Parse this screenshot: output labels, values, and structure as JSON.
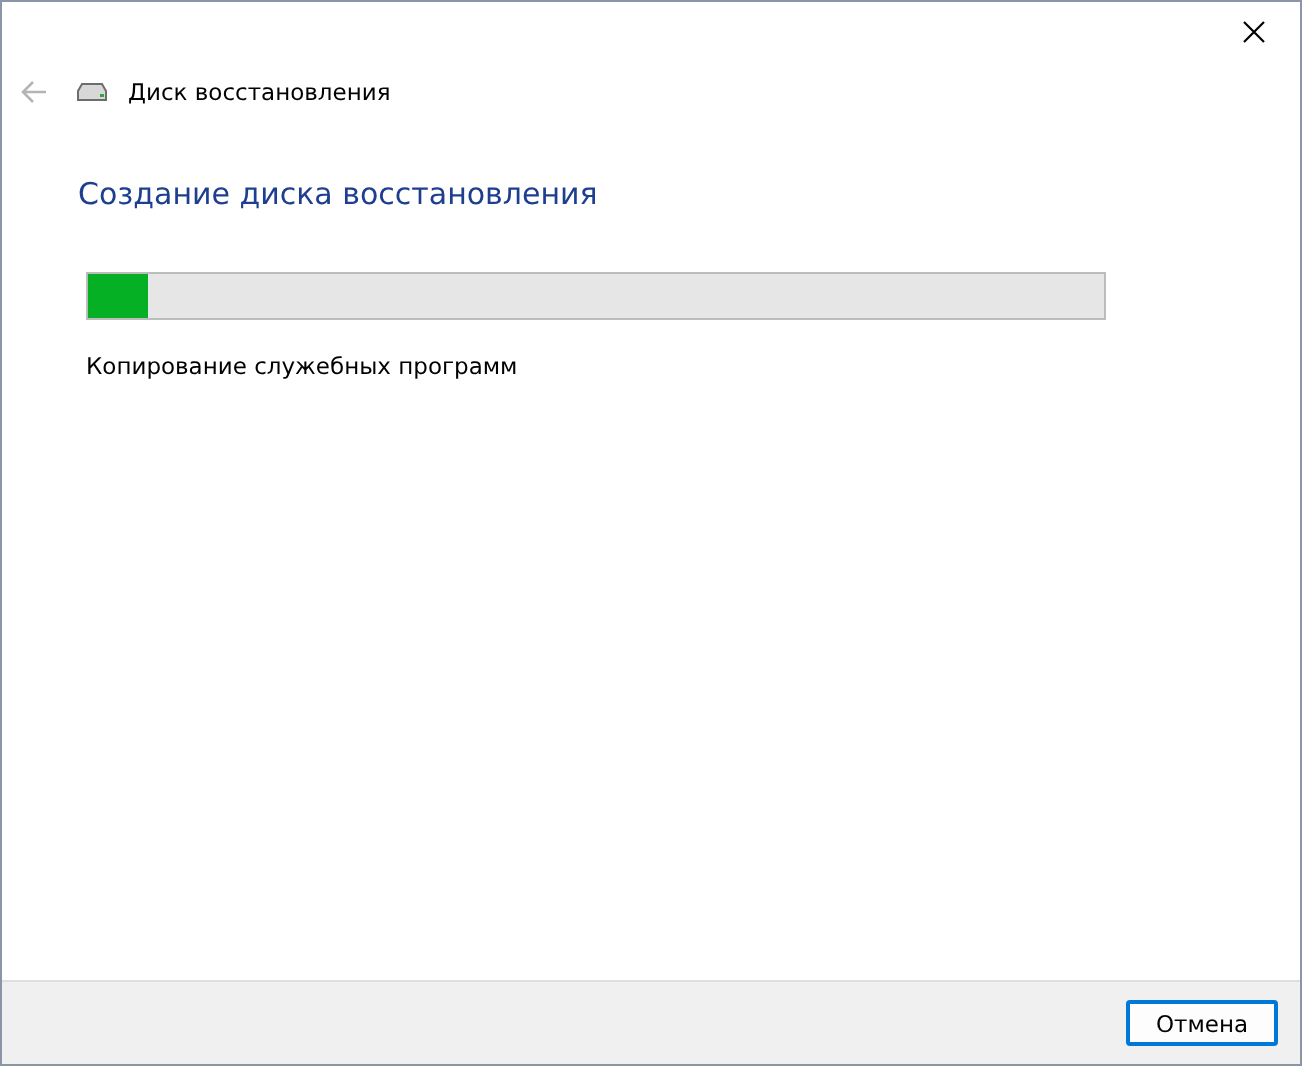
{
  "window": {
    "title": "Диск восстановления"
  },
  "back_button": {
    "disabled": true
  },
  "heading": "Создание диска восстановления",
  "progress": {
    "level": 0.06,
    "status": "Копирование служебных программ"
  },
  "buttons": [
    {
      "label": "Отмена",
      "default": true
    }
  ]
}
